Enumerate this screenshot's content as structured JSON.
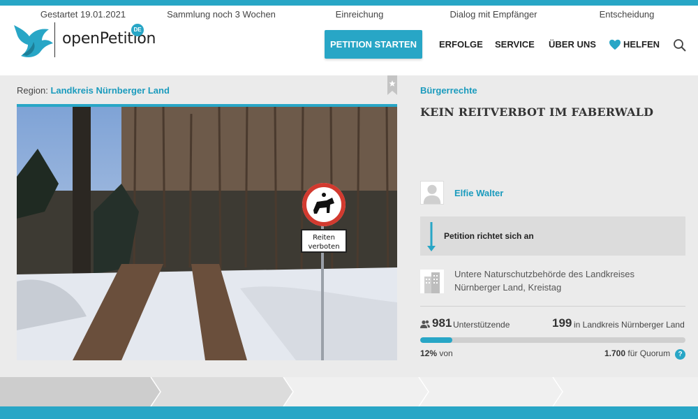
{
  "header": {
    "brand": "openPetition",
    "country_badge": "DE",
    "nav": {
      "start_label": "PETITION STARTEN",
      "erfolge": "ERFOLGE",
      "service": "SERVICE",
      "ueber_uns": "ÜBER UNS",
      "helfen": "HELFEN"
    },
    "icons": [
      "bird-logo",
      "heart-icon",
      "search-icon"
    ]
  },
  "region": {
    "prefix": "Region:",
    "name": "Landkreis Nürnberger Land"
  },
  "photo": {
    "sign_line1": "Reiten",
    "sign_line2": "verboten"
  },
  "petition": {
    "category": "Bürgerrechte",
    "title": "KEIN REITVERBOT IM FABERWALD",
    "author": "Elfie Walter",
    "recipient_label": "Petition richtet sich an",
    "recipient": "Untere Naturschutzbehörde des Landkreises Nürnberger Land, Kreistag"
  },
  "stats": {
    "supporters": "981",
    "supporters_label": "Unterstützende",
    "local": "199",
    "local_label": "in Landkreis Nürnberger Land",
    "percent": "12%",
    "percent_suffix": "von",
    "quorum": "1.700",
    "quorum_label": "für Quorum",
    "help": "?",
    "progress_fraction": 0.12
  },
  "steps": [
    {
      "label": "Gestartet 19.01.2021",
      "state": "done"
    },
    {
      "label": "Sammlung noch 3 Wochen",
      "state": "active"
    },
    {
      "label": "Einreichung",
      "state": "todo"
    },
    {
      "label": "Dialog mit Empfänger",
      "state": "todo"
    },
    {
      "label": "Entscheidung",
      "state": "todo"
    }
  ],
  "colors": {
    "accent": "#28a6c6",
    "link": "#1b9bbd",
    "background": "#ebebeb"
  }
}
